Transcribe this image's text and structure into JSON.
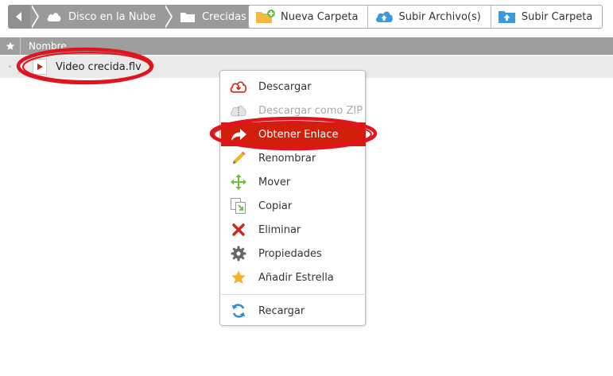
{
  "breadcrumb": {
    "items": [
      {
        "label": "Disco en la Nube",
        "icon": "cloud-icon"
      },
      {
        "label": "Crecidas",
        "icon": "folder-icon"
      }
    ]
  },
  "toolbar": {
    "buttons": [
      {
        "label": "Nueva Carpeta",
        "icon": "new-folder-icon"
      },
      {
        "label": "Subir Archivo(s)",
        "icon": "upload-cloud-icon"
      },
      {
        "label": "Subir Carpeta",
        "icon": "upload-folder-icon"
      }
    ]
  },
  "list": {
    "header_name": "Nombre",
    "rows": [
      {
        "name": "Video crecida.flv",
        "icon": "video-file-icon"
      }
    ]
  },
  "context_menu": {
    "items": [
      {
        "label": "Descargar",
        "icon": "download-icon"
      },
      {
        "label": "Descargar como ZIP",
        "icon": "zip-icon"
      },
      {
        "label": "Obtener Enlace",
        "icon": "share-arrow-icon"
      },
      {
        "label": "Renombrar",
        "icon": "pencil-icon"
      },
      {
        "label": "Mover",
        "icon": "move-icon"
      },
      {
        "label": "Copiar",
        "icon": "copy-icon"
      },
      {
        "label": "Eliminar",
        "icon": "delete-x-icon"
      },
      {
        "label": "Propiedades",
        "icon": "gear-icon"
      },
      {
        "label": "Añadir Estrella",
        "icon": "star-icon"
      },
      {
        "label": "Recargar",
        "icon": "reload-icon"
      }
    ],
    "highlighted": "Obtener Enlace"
  },
  "colors": {
    "highlight": "#d21f0c",
    "annotation": "#e0141e",
    "breadcrumb_bg": "#9a9a9a",
    "header_bg": "#9e9e9e"
  }
}
